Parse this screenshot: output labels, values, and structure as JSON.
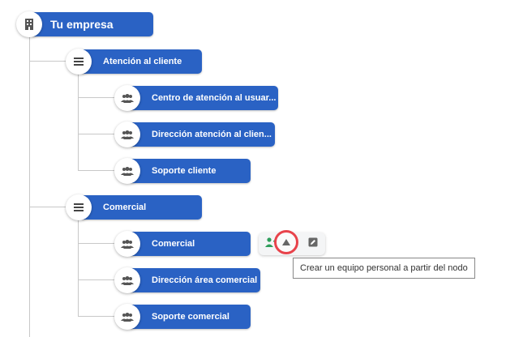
{
  "root": {
    "label": "Tu empresa",
    "icon": "building-icon"
  },
  "groups": [
    {
      "label": "Atención al cliente",
      "icon": "menu-icon",
      "children": [
        {
          "label": "Centro de atención al usuar...",
          "icon": "team-icon"
        },
        {
          "label": "Dirección atención al clien...",
          "icon": "team-icon"
        },
        {
          "label": "Soporte cliente",
          "icon": "team-icon"
        }
      ]
    },
    {
      "label": "Comercial",
      "icon": "menu-icon",
      "children": [
        {
          "label": "Comercial",
          "icon": "team-icon"
        },
        {
          "label": "Dirección área comercial",
          "icon": "team-icon"
        },
        {
          "label": "Soporte comercial",
          "icon": "team-icon"
        }
      ]
    }
  ],
  "actions": {
    "add_person_icon": "add-person-icon",
    "create_team_icon": "triangle-up-icon",
    "edit_icon": "edit-icon",
    "tooltip": "Crear un equipo personal a partir del nodo"
  },
  "colors": {
    "node_fill": "#2a62c4",
    "node_text": "#ffffff",
    "connector": "#c8c8c8",
    "highlight_ring": "#e8434b",
    "add_person_green": "#2e9e5b"
  }
}
